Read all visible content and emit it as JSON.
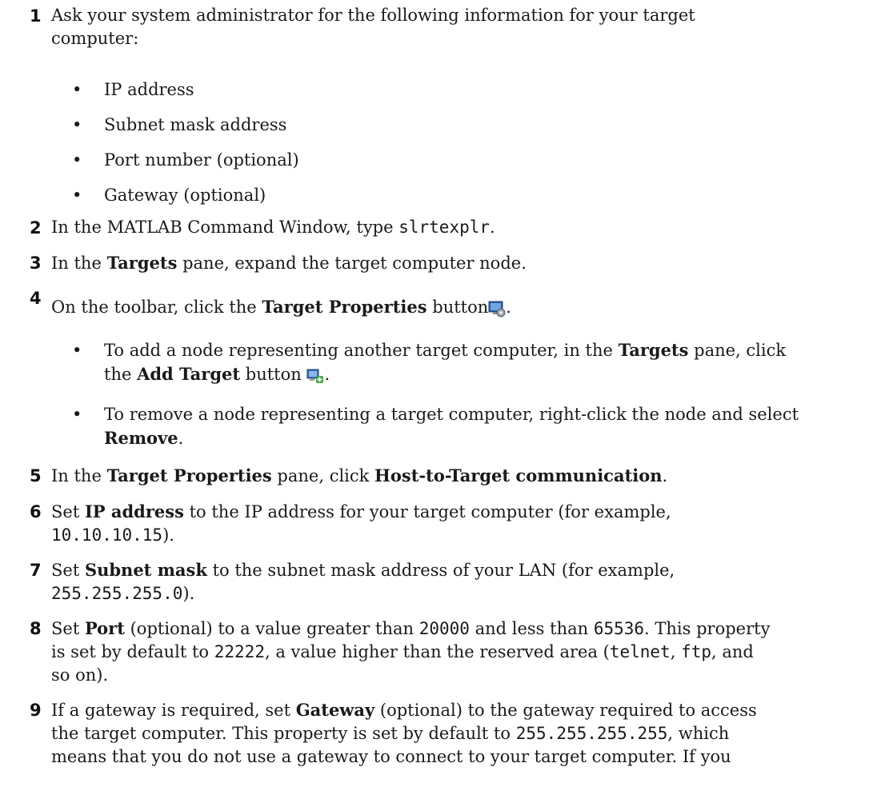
{
  "steps": {
    "s1": {
      "num": "1",
      "text": "Ask your system administrator for the following information for your target",
      "text2": "computer:"
    },
    "s1_bullets": [
      "IP address",
      "Subnet mask address",
      "Port number (optional)",
      "Gateway (optional)"
    ],
    "s2": {
      "num": "2",
      "pre": "In the MATLAB Command Window, type ",
      "code": "slrtexplr",
      "post": "."
    },
    "s3": {
      "num": "3",
      "pre": "In the ",
      "bold": "Targets",
      "post": " pane, expand the target computer node."
    },
    "s4": {
      "num": "4",
      "pre": "On the toolbar, click the ",
      "bold": "Target Properties",
      "post": " button",
      "post2": "."
    },
    "s4_b1": {
      "pre": "To add a node representing another target computer, in the ",
      "bold": "Targets",
      "post": " pane, click",
      "pre2": "the ",
      "bold2": "Add Target",
      "post2": " button ",
      "post3": "."
    },
    "s4_b2": {
      "line1": "To remove a node representing a target computer, right-click the node and select",
      "bold": "Remove",
      "post": "."
    },
    "s5": {
      "num": "5",
      "pre": "In the ",
      "bold": "Target Properties",
      "mid": " pane, click ",
      "bold2": "Host-to-Target communication",
      "post": "."
    },
    "s6": {
      "num": "6",
      "pre": "Set ",
      "bold": "IP address",
      "post": " to the IP address for your target computer (for example,",
      "code": "10.10.10.15",
      "post2": ")."
    },
    "s7": {
      "num": "7",
      "pre": "Set ",
      "bold": "Subnet mask",
      "post": " to the subnet mask address of your LAN (for example,",
      "code": "255.255.255.0",
      "post2": ")."
    },
    "s8": {
      "num": "8",
      "pre": "Set ",
      "bold": "Port",
      "mid": " (optional) to a value greater than ",
      "code1": "20000",
      "mid2": " and less than ",
      "code2": "65536",
      "post": ". This property",
      "l2a": "is set by default to ",
      "code3": "22222",
      "l2b": ", a value higher than the reserved area (",
      "code4": "telnet",
      "l2c": ", ",
      "code5": "ftp",
      "l2d": ", and",
      "l3": "so on)."
    },
    "s9": {
      "num": "9",
      "pre": "If a gateway is required, set ",
      "bold": "Gateway",
      "post": " (optional) to the gateway required to access",
      "l2": "the target computer. This property is set by default to ",
      "code": "255.255.255.255",
      "l2b": ", which",
      "l3": "means that you do not use a gateway to connect to your target computer. If you"
    }
  },
  "icons": {
    "target_properties": "target-properties-icon",
    "add_target": "add-target-icon"
  }
}
